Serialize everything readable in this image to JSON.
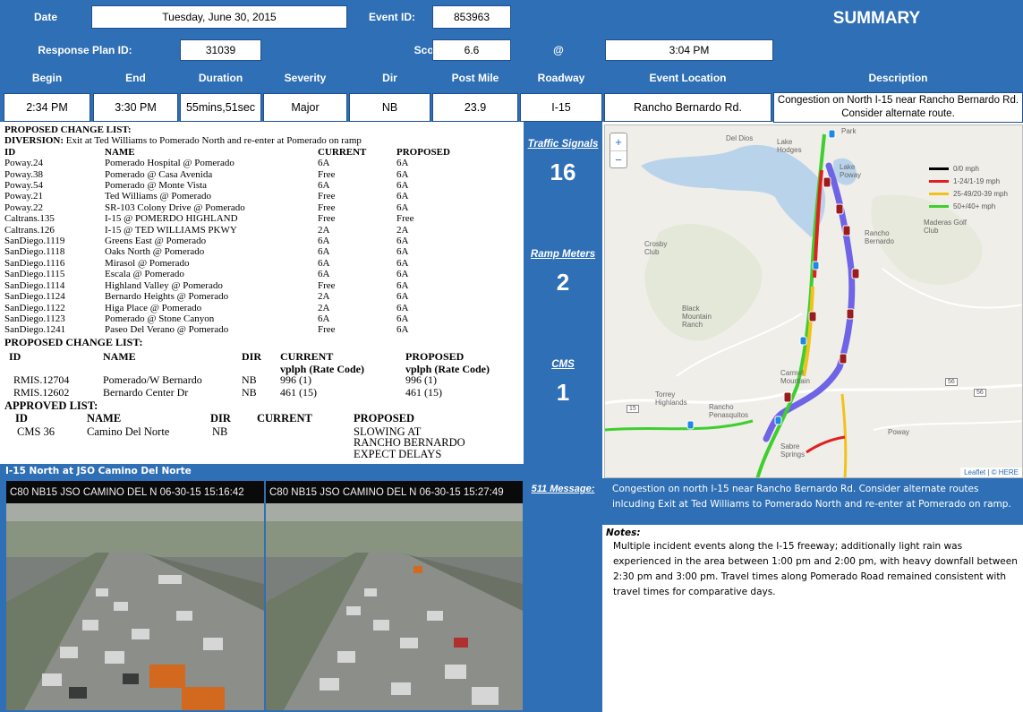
{
  "header": {
    "date_label": "Date",
    "date_value": "Tuesday, June 30, 2015",
    "event_id_label": "Event ID:",
    "event_id_value": "853963",
    "summary_title": "SUMMARY",
    "response_plan_label": "Response Plan ID:",
    "response_plan_value": "31039",
    "score_label": "Score:",
    "score_value": "6.6",
    "at_label": "@",
    "time_value": "3:04 PM"
  },
  "event_table": {
    "columns": [
      "Begin",
      "End",
      "Duration",
      "Severity",
      "Dir",
      "Post Mile",
      "Roadway",
      "Event Location",
      "Description"
    ],
    "row": [
      "2:34 PM",
      "3:30 PM",
      "55mins,51sec",
      "Major",
      "NB",
      "23.9",
      "I-15",
      "Rancho Bernardo Rd.",
      "Congestion on North I-15 near Rancho Bernardo Rd. Consider alternate route."
    ]
  },
  "signals_plan": {
    "title": "PROPOSED CHANGE LIST:",
    "diversion_label": "DIVERSION:",
    "diversion_text": "Exit at Ted Williams to Pomerado North and re-enter at Pomerado on ramp",
    "headers": [
      "ID",
      "NAME",
      "CURRENT",
      "PROPOSED"
    ],
    "rows": [
      [
        "Poway.24",
        "Pomerado Hospital @ Pomerado",
        "6A",
        "6A"
      ],
      [
        "Poway.38",
        "Pomerado @ Casa Avenida",
        "Free",
        "6A"
      ],
      [
        "Poway.54",
        "Pomerado @ Monte Vista",
        "6A",
        "6A"
      ],
      [
        "Poway.21",
        "Ted Williams @ Pomerado",
        "Free",
        "6A"
      ],
      [
        "Poway.22",
        "SR-103 Colony Drive @ Pomerado",
        "Free",
        "6A"
      ],
      [
        "Caltrans.135",
        "I-15 @ POMERDO HIGHLAND",
        "Free",
        "Free"
      ],
      [
        "Caltrans.126",
        "I-15 @ TED WILLIAMS PKWY",
        "2A",
        "2A"
      ],
      [
        "SanDiego.1119",
        "Greens East @ Pomerado",
        "6A",
        "6A"
      ],
      [
        "SanDiego.1118",
        "Oaks North @ Pomerado",
        "6A",
        "6A"
      ],
      [
        "SanDiego.1116",
        "Mirasol @ Pomerado",
        "6A",
        "6A"
      ],
      [
        "SanDiego.1115",
        "Escala @ Pomerado",
        "6A",
        "6A"
      ],
      [
        "SanDiego.1114",
        "Highland Valley @ Pomerado",
        "Free",
        "6A"
      ],
      [
        "SanDiego.1124",
        "Bernardo Heights @ Pomerado",
        "2A",
        "6A"
      ],
      [
        "SanDiego.1122",
        "Higa Place @ Pomerado",
        "2A",
        "6A"
      ],
      [
        "SanDiego.1123",
        "Pomerado @ Stone Canyon",
        "6A",
        "6A"
      ],
      [
        "SanDiego.1241",
        "Paseo Del Verano @ Pomerado",
        "Free",
        "6A"
      ]
    ]
  },
  "ramp_plan": {
    "title": "PROPOSED CHANGE LIST:",
    "headers": [
      "ID",
      "NAME",
      "DIR",
      "CURRENT",
      "PROPOSED"
    ],
    "subheader": "vplph (Rate Code)",
    "rows": [
      [
        "RMIS.12704",
        "Pomerado/W Bernardo",
        "NB",
        "996 (1)",
        "996 (1)"
      ],
      [
        "RMIS.12602",
        "Bernardo Center Dr",
        "NB",
        "461 (15)",
        "461 (15)"
      ]
    ]
  },
  "cms_plan": {
    "title": "APPROVED LIST:",
    "headers": [
      "ID",
      "NAME",
      "DIR",
      "CURRENT",
      "PROPOSED"
    ],
    "row": [
      "CMS 36",
      "Camino Del Norte",
      "NB",
      ""
    ],
    "proposed_lines": [
      "SLOWING AT",
      "RANCHO BERNARDO",
      "EXPECT DELAYS"
    ]
  },
  "counts": {
    "traffic_signals_label": "Traffic Signals",
    "traffic_signals_value": "16",
    "ramp_meters_label": "Ramp Meters",
    "ramp_meters_value": "2",
    "cms_label": "CMS",
    "cms_value": "1"
  },
  "map": {
    "zoom_in": "+",
    "zoom_out": "−",
    "legend": [
      {
        "label": "0/0 mph",
        "color": "#000000"
      },
      {
        "label": "1-24/1-19 mph",
        "color": "#e02020"
      },
      {
        "label": "25-49/20-39 mph",
        "color": "#f2c21a"
      },
      {
        "label": "50+/40+ mph",
        "color": "#3ecf2e"
      }
    ],
    "place_labels": [
      "Del Dios",
      "Lake Hodges",
      "Lake Poway",
      "Crosby Club",
      "Rancho Bernardo",
      "Maderas Golf Club",
      "Black Mountain Ranch",
      "Carmel Mountain",
      "Torrey Highlands",
      "Rancho Penasquitos",
      "Sabre Springs",
      "Poway",
      "Park"
    ],
    "route_labels": [
      "15",
      "56",
      "56"
    ],
    "attribution": "Leaflet | © HERE"
  },
  "camera": {
    "section_title": "I-15 North at JSO Camino Del Norte",
    "captions": [
      "C80 NB15 JSO CAMINO DEL N 06-30-15  15:16:42",
      "C80 NB15 JSO CAMINO DEL N 06-30-15  15:27:49"
    ]
  },
  "message": {
    "label": "511 Message:",
    "text": "Congestion on north I-15 near Rancho Bernardo Rd. Consider alternate routes inlcuding Exit at Ted Williams to Pomerado North and re-enter at Pomerado on ramp."
  },
  "notes": {
    "label": "Notes:",
    "text": "Multiple incident events along the I-15 freeway; additionally light rain was experienced in the area between 1:00 pm and 2:00 pm, with heavy downfall between 2:30 pm and 3:00 pm.  Travel times along Pomerado Road remained consistent with travel times for comparative days."
  },
  "colors": {
    "brand_blue": "#2f6fb5",
    "route_blue": "#6f63e6",
    "congestion_red": "#e02020",
    "moderate_yellow": "#f2c21a",
    "free_flow_green": "#3ecf2e"
  }
}
